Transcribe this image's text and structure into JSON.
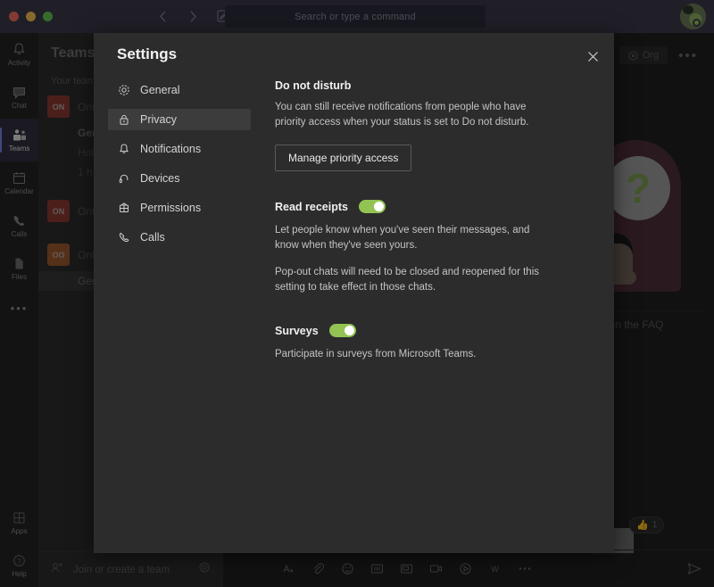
{
  "titlebar": {
    "back_icon": "chevron-left-icon",
    "forward_icon": "chevron-right-icon",
    "compose_icon": "new-chat-icon",
    "search_placeholder": "Search or type a command",
    "avatar_name": "user-avatar"
  },
  "rail": {
    "items": [
      {
        "label": "Activity",
        "icon": "bell-icon",
        "active": false
      },
      {
        "label": "Chat",
        "icon": "chat-icon",
        "active": false
      },
      {
        "label": "Teams",
        "icon": "teams-icon",
        "active": true
      },
      {
        "label": "Calendar",
        "icon": "calendar-icon",
        "active": false
      },
      {
        "label": "Calls",
        "icon": "phone-icon",
        "active": false
      },
      {
        "label": "Files",
        "icon": "file-icon",
        "active": false
      }
    ],
    "more_label": "•••",
    "bottom": [
      {
        "label": "Apps",
        "icon": "apps-icon"
      },
      {
        "label": "Help",
        "icon": "help-icon"
      }
    ]
  },
  "teams_pane": {
    "title": "Teams",
    "section_label": "Your teams",
    "teams": [
      {
        "avatar_initials": "ON",
        "avatar_color": "#8a3a32",
        "name": "Onl",
        "channels": [
          {
            "label": "Ger",
            "bold": true,
            "selected": false
          },
          {
            "label": "Hol",
            "bold": false,
            "selected": false
          },
          {
            "label": "1 h",
            "bold": false,
            "selected": false
          }
        ]
      },
      {
        "avatar_initials": "ON",
        "avatar_color": "#8a3a32",
        "name": "Onl",
        "channels": []
      },
      {
        "avatar_initials": "OO",
        "avatar_color": "#9c5a2e",
        "name": "Onl",
        "channels": [
          {
            "label": "Ger",
            "bold": false,
            "selected": true
          }
        ]
      }
    ],
    "join_label": "Join or create a team",
    "join_icon": "add-team-icon",
    "settings_icon": "gear-icon"
  },
  "main": {
    "org_label": "Org",
    "org_icon": "org-chart-icon",
    "more_label": "•••",
    "faq_label": "en the FAQ",
    "reaction_emoji": "👍",
    "reaction_count": "1",
    "compose_icons": [
      "format-icon",
      "attach-icon",
      "emoji-icon",
      "giphy-icon",
      "sticker-icon",
      "meet-now-icon",
      "stream-icon",
      "word-icon",
      "more-icon"
    ],
    "send_icon": "send-icon"
  },
  "dialog": {
    "title": "Settings",
    "close_icon": "close-icon",
    "nav": [
      {
        "label": "General",
        "icon": "gear-icon",
        "active": false
      },
      {
        "label": "Privacy",
        "icon": "lock-icon",
        "active": true
      },
      {
        "label": "Notifications",
        "icon": "bell-icon",
        "active": false
      },
      {
        "label": "Devices",
        "icon": "headset-icon",
        "active": false
      },
      {
        "label": "Permissions",
        "icon": "permissions-icon",
        "active": false
      },
      {
        "label": "Calls",
        "icon": "phone-icon",
        "active": false
      }
    ],
    "dnd": {
      "heading": "Do not disturb",
      "description": "You can still receive notifications from people who have priority access when your status is set to Do not disturb.",
      "button_label": "Manage priority access"
    },
    "read_receipts": {
      "label": "Read receipts",
      "toggle_state": "on",
      "description1": "Let people know when you've seen their messages, and know when they've seen yours.",
      "description2": "Pop-out chats will need to be closed and reopened for this setting to take effect in those chats."
    },
    "surveys": {
      "label": "Surveys",
      "toggle_state": "on",
      "description": "Participate in surveys from Microsoft Teams."
    }
  },
  "colors": {
    "accent": "#7b83eb",
    "toggle_on": "#92c353",
    "titlebar": "#3b3a4a",
    "dialog_bg": "#2d2c2c"
  }
}
